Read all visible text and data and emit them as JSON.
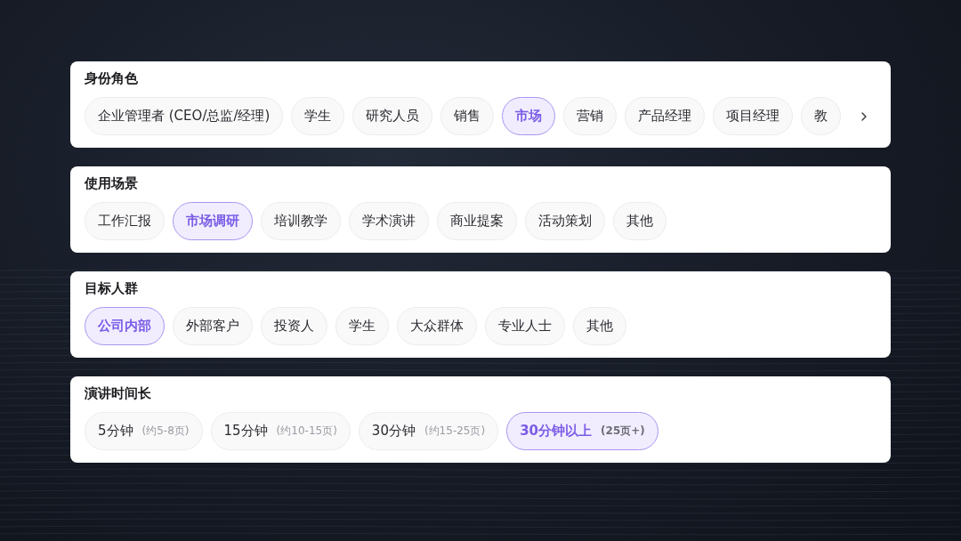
{
  "sections": [
    {
      "title": "身份角色",
      "has_more": true,
      "options": [
        {
          "label": "企业管理者 (CEO/总监/经理)",
          "selected": false
        },
        {
          "label": "学生",
          "selected": false
        },
        {
          "label": "研究人员",
          "selected": false
        },
        {
          "label": "销售",
          "selected": false
        },
        {
          "label": "市场",
          "selected": true
        },
        {
          "label": "营销",
          "selected": false
        },
        {
          "label": "产品经理",
          "selected": false
        },
        {
          "label": "项目经理",
          "selected": false
        },
        {
          "label": "教",
          "selected": false
        }
      ]
    },
    {
      "title": "使用场景",
      "has_more": false,
      "options": [
        {
          "label": "工作汇报",
          "selected": false
        },
        {
          "label": "市场调研",
          "selected": true
        },
        {
          "label": "培训教学",
          "selected": false
        },
        {
          "label": "学术演讲",
          "selected": false
        },
        {
          "label": "商业提案",
          "selected": false
        },
        {
          "label": "活动策划",
          "selected": false
        },
        {
          "label": "其他",
          "selected": false
        }
      ]
    },
    {
      "title": "目标人群",
      "has_more": false,
      "options": [
        {
          "label": "公司内部",
          "selected": true
        },
        {
          "label": "外部客户",
          "selected": false
        },
        {
          "label": "投资人",
          "selected": false
        },
        {
          "label": "学生",
          "selected": false
        },
        {
          "label": "大众群体",
          "selected": false
        },
        {
          "label": "专业人士",
          "selected": false
        },
        {
          "label": "其他",
          "selected": false
        }
      ]
    },
    {
      "title": "演讲时间长",
      "has_more": false,
      "options": [
        {
          "label": "5分钟",
          "note": "(约5-8页)",
          "selected": false
        },
        {
          "label": "15分钟",
          "note": "(约10-15页)",
          "selected": false
        },
        {
          "label": "30分钟",
          "note": "(约15-25页)",
          "selected": false
        },
        {
          "label": "30分钟以上",
          "note": "(25页+)",
          "selected": true
        }
      ]
    }
  ]
}
